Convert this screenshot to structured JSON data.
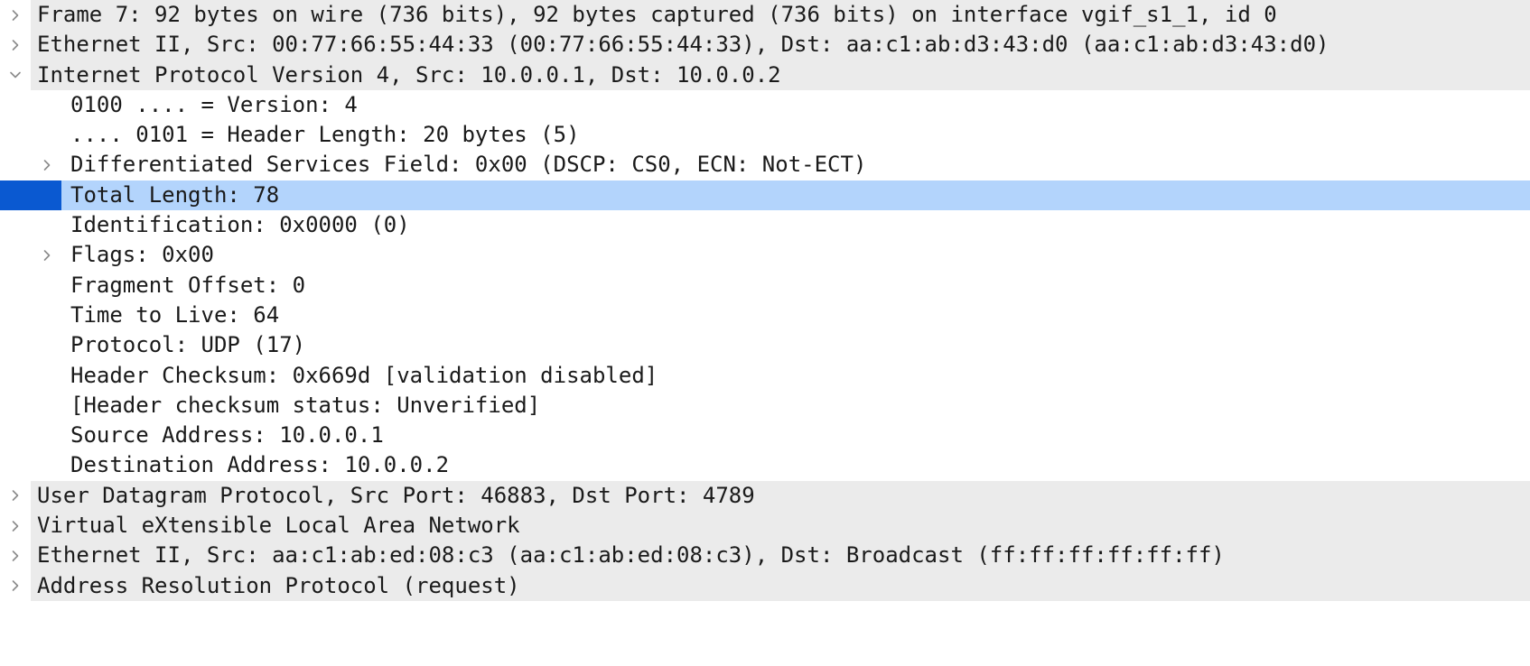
{
  "packet_details": {
    "rows": [
      {
        "text": "Frame 7: 92 bytes on wire (736 bits), 92 bytes captured (736 bits) on interface vgif_s1_1, id 0",
        "level": 0,
        "expander": "collapsed",
        "selected": false
      },
      {
        "text": "Ethernet II, Src: 00:77:66:55:44:33 (00:77:66:55:44:33), Dst: aa:c1:ab:d3:43:d0 (aa:c1:ab:d3:43:d0)",
        "level": 0,
        "expander": "collapsed",
        "selected": false
      },
      {
        "text": "Internet Protocol Version 4, Src: 10.0.0.1, Dst: 10.0.0.2",
        "level": 0,
        "expander": "expanded",
        "selected": false
      },
      {
        "text": "0100 .... = Version: 4",
        "level": 1,
        "expander": "none",
        "selected": false
      },
      {
        "text": ".... 0101 = Header Length: 20 bytes (5)",
        "level": 1,
        "expander": "none",
        "selected": false
      },
      {
        "text": "Differentiated Services Field: 0x00 (DSCP: CS0, ECN: Not-ECT)",
        "level": 1,
        "expander": "collapsed",
        "selected": false
      },
      {
        "text": "Total Length: 78",
        "level": 1,
        "expander": "none",
        "selected": true
      },
      {
        "text": "Identification: 0x0000 (0)",
        "level": 1,
        "expander": "none",
        "selected": false
      },
      {
        "text": "Flags: 0x00",
        "level": 1,
        "expander": "collapsed",
        "selected": false
      },
      {
        "text": "Fragment Offset: 0",
        "level": 1,
        "expander": "none",
        "selected": false
      },
      {
        "text": "Time to Live: 64",
        "level": 1,
        "expander": "none",
        "selected": false
      },
      {
        "text": "Protocol: UDP (17)",
        "level": 1,
        "expander": "none",
        "selected": false
      },
      {
        "text": "Header Checksum: 0x669d [validation disabled]",
        "level": 1,
        "expander": "none",
        "selected": false
      },
      {
        "text": "[Header checksum status: Unverified]",
        "level": 1,
        "expander": "none",
        "selected": false
      },
      {
        "text": "Source Address: 10.0.0.1",
        "level": 1,
        "expander": "none",
        "selected": false
      },
      {
        "text": "Destination Address: 10.0.0.2",
        "level": 1,
        "expander": "none",
        "selected": false
      },
      {
        "text": "User Datagram Protocol, Src Port: 46883, Dst Port: 4789",
        "level": 0,
        "expander": "collapsed",
        "selected": false
      },
      {
        "text": "Virtual eXtensible Local Area Network",
        "level": 0,
        "expander": "collapsed",
        "selected": false
      },
      {
        "text": "Ethernet II, Src: aa:c1:ab:ed:08:c3 (aa:c1:ab:ed:08:c3), Dst: Broadcast (ff:ff:ff:ff:ff:ff)",
        "level": 0,
        "expander": "collapsed",
        "selected": false
      },
      {
        "text": "Address Resolution Protocol (request)",
        "level": 0,
        "expander": "collapsed",
        "selected": false
      }
    ]
  },
  "icons": {
    "collapsed": "chevron-right-icon",
    "expanded": "chevron-down-icon"
  },
  "colors": {
    "top_level_row_bg": "#ebebeb",
    "selected_row_bg": "#b3d4fc",
    "selection_marker": "#0a59d1",
    "text": "#1a1a1a",
    "chevron": "#8a8a8a"
  }
}
